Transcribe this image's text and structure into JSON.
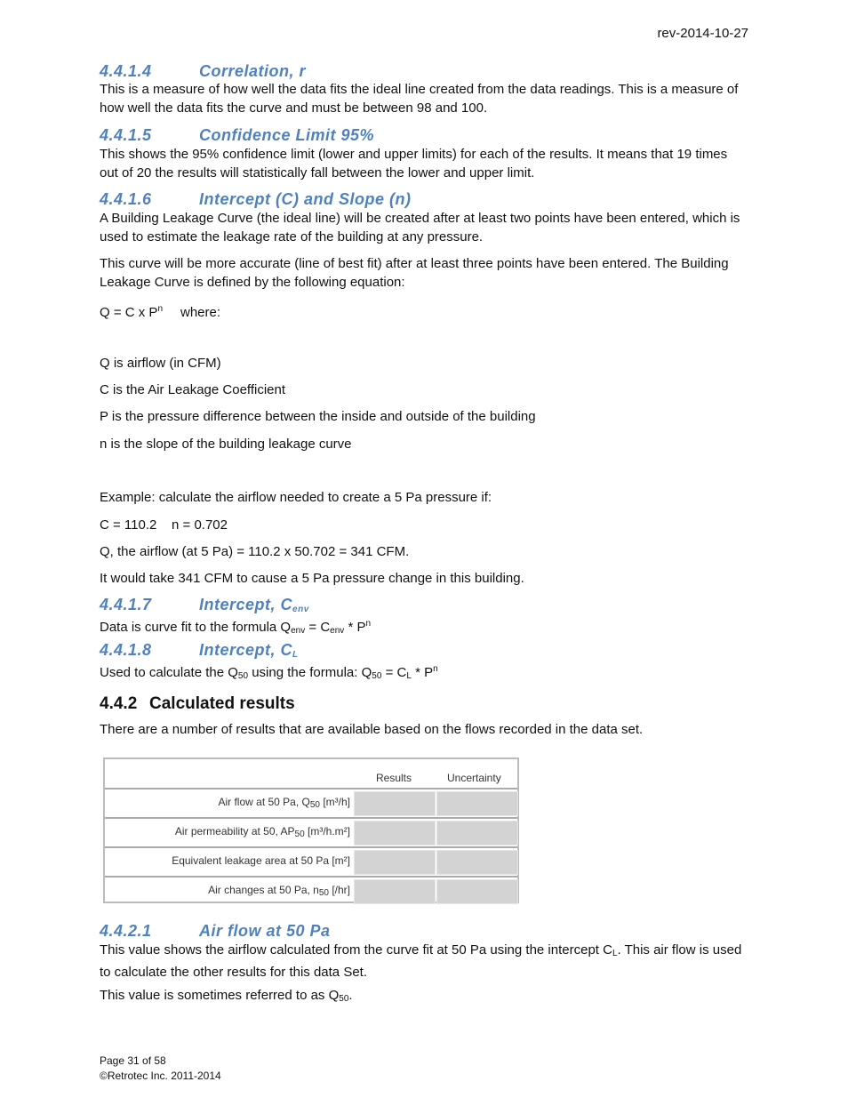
{
  "header": {
    "revision": "rev-2014-10-27"
  },
  "s1": {
    "num": "4.4.1.4",
    "title": "Correlation, r",
    "body": "This is a measure of how well the data fits the ideal line created from the data readings.  This is a measure of how well the data fits the curve and must be between 98 and 100."
  },
  "s2": {
    "num": "4.4.1.5",
    "title": "Confidence Limit 95%",
    "body": "This shows the 95% confidence limit (lower and upper limits) for each of the results.  It means that 19 times out of 20 the results will statistically fall between the lower and upper limit."
  },
  "s3": {
    "num": "4.4.1.6",
    "title": "Intercept (C) and Slope (n)",
    "p1": "A Building Leakage Curve (the ideal line) will be created after at least two points have been entered, which is used to estimate the leakage rate of the building at any pressure.",
    "p2": "This curve will be more accurate (line of best fit) after at least three points have been entered.  The Building Leakage Curve is defined by the following equation:",
    "eq_a": "Q = C x P",
    "eq_sup": "n",
    "eq_b": "where:",
    "defs": [
      "Q is airflow (in CFM)",
      "C is the Air Leakage Coefficient",
      "P is the pressure difference between the inside and outside of the building",
      "n is the slope of the building leakage curve"
    ],
    "example": "Example:  calculate the airflow needed to create a 5 Pa pressure if:",
    "values": "C = 110.2    n = 0.702",
    "calc": "Q, the airflow (at 5 Pa) = 110.2 x 50.702 = 341 CFM.",
    "conclusion": "It would take 341 CFM to cause a 5 Pa pressure change in this building."
  },
  "s4": {
    "num": "4.4.1.7",
    "title": "Intercept, C",
    "title_sub": "env",
    "t1": "Data is curve fit to the formula Q",
    "sub1": "env",
    "t2": " = C",
    "sub2": "env",
    "t3": " * P",
    "sup": "n"
  },
  "s5": {
    "num": "4.4.1.8",
    "title": "Intercept, C",
    "title_sub": "L",
    "t1": "Used to calculate the Q",
    "sub1": "50",
    "t2": " using the formula:  Q",
    "sub2": "50",
    "t3": " = C",
    "sub3": "L",
    "t4": " * P",
    "sup": "n"
  },
  "s6": {
    "num": "4.4.2",
    "title": "Calculated results",
    "body": "There are a number of results that are available based on the flows recorded in the data set."
  },
  "table": {
    "col1": "Results",
    "col2": "Uncertainty",
    "rows": [
      {
        "a": "Air flow at 50 Pa, Q",
        "sub": "50",
        "b": " [m³/h]"
      },
      {
        "a": "Air permeability at 50, AP",
        "sub": "50",
        "b": " [m³/h.m²]"
      },
      {
        "a": "Equivalent leakage area at 50 Pa",
        "sub": "",
        "b": " [m²]"
      },
      {
        "a": "Air changes at 50 Pa, n",
        "sub": "50",
        "b": " [/hr]"
      }
    ]
  },
  "s7": {
    "num": "4.4.2.1",
    "title": "Air flow at 50 Pa",
    "t1": "This value shows the airflow calculated from the curve fit at 50 Pa using the intercept C",
    "sub1": "L",
    "t2": ".  This air flow is used to calculate the other results for this data Set.",
    "p2a": "This value is sometimes referred to as Q",
    "p2sub": "50",
    "p2b": "."
  },
  "footer": {
    "page": "Page 31 of 58",
    "copyright": "©Retrotec Inc. 2011-2014"
  },
  "colors": {
    "heading": "#4F81BD",
    "cell": "#D3D3D3"
  }
}
